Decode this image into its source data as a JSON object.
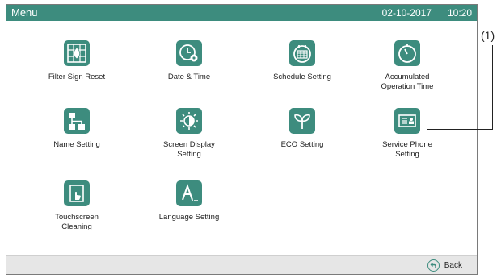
{
  "header": {
    "title": "Menu",
    "date": "02-10-2017",
    "time": "10:20"
  },
  "menu": {
    "items": [
      {
        "label": "Filter Sign Reset",
        "icon": "filter-icon"
      },
      {
        "label": "Date & Time",
        "icon": "clock-gear-icon"
      },
      {
        "label": "Schedule Setting",
        "icon": "calendar-icon"
      },
      {
        "label": "Accumulated\nOperation Time",
        "icon": "timer-icon"
      },
      {
        "label": "Name Setting",
        "icon": "hierarchy-icon"
      },
      {
        "label": "Screen Display\nSetting",
        "icon": "brightness-icon"
      },
      {
        "label": "ECO Setting",
        "icon": "leaf-icon"
      },
      {
        "label": "Service Phone\nSetting",
        "icon": "contact-card-icon"
      },
      {
        "label": "Touchscreen\nCleaning",
        "icon": "touchscreen-icon"
      },
      {
        "label": "Language Setting",
        "icon": "language-icon"
      }
    ]
  },
  "footer": {
    "back_label": "Back",
    "back_icon": "back-arrow-icon"
  },
  "annotation": {
    "callout": "(1)"
  },
  "colors": {
    "accent": "#3d8c7e",
    "footer_bg": "#e6e6e6"
  }
}
